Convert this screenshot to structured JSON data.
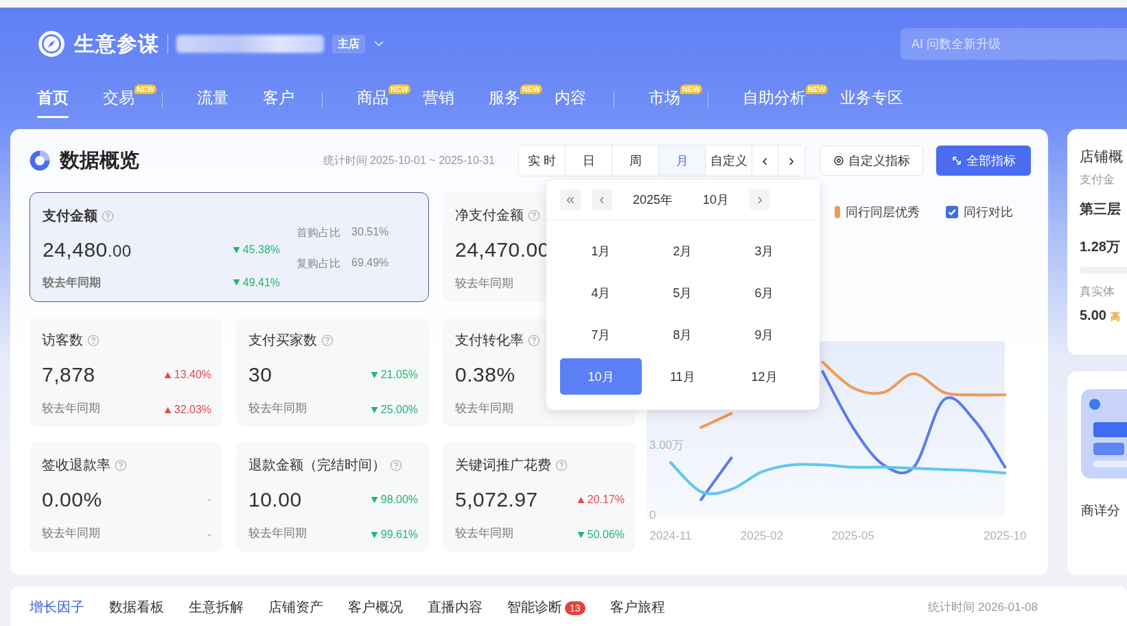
{
  "header": {
    "app_name": "生意参谋",
    "store_badge": "主店",
    "search": {
      "placeholder": "AI 问数全新升级"
    }
  },
  "nav": {
    "groups": [
      [
        {
          "label": "首页",
          "selected": true
        },
        {
          "label": "交易",
          "badge": "NEW",
          "selected": false
        }
      ],
      [
        {
          "label": "流量",
          "selected": false
        },
        {
          "label": "客户",
          "selected": false
        }
      ],
      [
        {
          "label": "商品",
          "badge": "NEW",
          "selected": false
        },
        {
          "label": "营销",
          "selected": false
        },
        {
          "label": "服务",
          "badge": "NEW",
          "selected": false
        },
        {
          "label": "内容",
          "selected": false
        }
      ],
      [
        {
          "label": "市场",
          "badge": "NEW",
          "selected": false
        }
      ],
      [
        {
          "label": "自助分析",
          "badge": "NEW",
          "selected": false
        },
        {
          "label": "业务专区",
          "selected": false
        }
      ]
    ]
  },
  "overview": {
    "title": "数据概览",
    "period": "统计时间 2025-10-01 ~ 2025-10-31",
    "segments": [
      {
        "label": "实 时",
        "selected": false
      },
      {
        "label": "日",
        "selected": false
      },
      {
        "label": "周",
        "selected": false
      },
      {
        "label": "月",
        "selected": true
      },
      {
        "label": "自定义",
        "selected": false
      }
    ],
    "prev": "‹",
    "next": "›",
    "custom_metrics_button": "自定义指标",
    "all_metrics_button": "全部指标"
  },
  "metrics": [
    {
      "title": "支付金额",
      "value": "24,480",
      "value_small": ".00",
      "compare_label": "较去年同期",
      "selected": true,
      "wide": true,
      "changes": [
        {
          "kind": "down",
          "text": "45.38%"
        },
        {
          "kind": "down",
          "text": "49.41%"
        }
      ],
      "shares": [
        {
          "label": "首购占比",
          "value": "30.51%"
        },
        {
          "label": "复购占比",
          "value": "69.49%"
        }
      ]
    },
    {
      "title": "净支付金额",
      "value": "24,470.00",
      "compare_label": "较去年同期",
      "selected": false,
      "wide": false
    },
    {
      "title": "访客数",
      "value": "7,878",
      "compare_label": "较去年同期",
      "selected": false,
      "wide": false,
      "changes": [
        {
          "kind": "up",
          "text": "13.40%"
        },
        {
          "kind": "up",
          "text": "32.03%"
        }
      ]
    },
    {
      "title": "支付买家数",
      "value": "30",
      "compare_label": "较去年同期",
      "selected": false,
      "wide": false,
      "changes": [
        {
          "kind": "down",
          "text": "21.05%"
        },
        {
          "kind": "down",
          "text": "25.00%"
        }
      ]
    },
    {
      "title": "支付转化率",
      "value": "0.38%",
      "compare_label": "较去年同期",
      "selected": false,
      "wide": false
    },
    {
      "title": "签收退款率",
      "value": "0.00%",
      "compare_label": "较去年同期",
      "selected": false,
      "wide": false,
      "changes": [
        {
          "kind": "none",
          "text": "-"
        },
        {
          "kind": "none",
          "text": "-"
        }
      ]
    },
    {
      "title": "退款金额（完结时间）",
      "value": "10.00",
      "compare_label": "较去年同期",
      "selected": false,
      "wide": false,
      "changes": [
        {
          "kind": "down",
          "text": "98.00%"
        },
        {
          "kind": "down",
          "text": "99.61%"
        }
      ]
    },
    {
      "title": "关键词推广花费",
      "value": "5,072.97",
      "compare_label": "较去年同期",
      "selected": false,
      "wide": false,
      "changes": [
        {
          "kind": "up",
          "text": "20.17%"
        },
        {
          "kind": "down",
          "text": "50.06%"
        }
      ]
    }
  ],
  "month_picker": {
    "fast_prev": "«",
    "prev": "‹",
    "year": "2025年",
    "month": "10月",
    "next": "›",
    "months": [
      {
        "label": "1月",
        "selected": false
      },
      {
        "label": "2月",
        "selected": false
      },
      {
        "label": "3月",
        "selected": false
      },
      {
        "label": "4月",
        "selected": false
      },
      {
        "label": "5月",
        "selected": false
      },
      {
        "label": "6月",
        "selected": false
      },
      {
        "label": "7月",
        "selected": false
      },
      {
        "label": "8月",
        "selected": false
      },
      {
        "label": "9月",
        "selected": false
      },
      {
        "label": "10月",
        "selected": true
      },
      {
        "label": "11月",
        "selected": false
      },
      {
        "label": "12月",
        "selected": false
      }
    ]
  },
  "chart": {
    "compare_checkbox": {
      "label": "同行对比",
      "checked": true
    },
    "chart_data": {
      "type": "line",
      "categories": [
        "2024-11",
        null,
        null,
        "2025-02",
        null,
        null,
        "2025-05",
        null,
        null,
        null,
        null,
        "2025-10"
      ],
      "ylim": [
        0,
        7.5
      ],
      "yticks": [
        {
          "value": 0,
          "label": "0"
        },
        {
          "value": 3,
          "label": "3.00万"
        }
      ],
      "series": [
        {
          "name": "同行同层优秀",
          "color": "#ef9a54",
          "values": [
            null,
            3.8,
            4.4,
            null,
            null,
            6.6,
            5.5,
            5.3,
            6.1,
            5.3,
            5.2,
            5.2
          ]
        },
        {
          "color": "#5b7be8",
          "values": [
            null,
            0.7,
            2.5,
            null,
            null,
            6.2,
            3.8,
            2.2,
            2.1,
            5.0,
            4.1,
            2.1
          ]
        },
        {
          "color": "#5ec8ec",
          "values": [
            2.3,
            1.05,
            1.15,
            1.9,
            2.2,
            2.2,
            2.1,
            2.1,
            2.05,
            2.0,
            1.95,
            1.85
          ]
        }
      ]
    }
  },
  "side_panel": {
    "title": "店铺概",
    "subtitle": "支付金",
    "tier": "第三层",
    "amount": "1.28万",
    "real_label": "真实体",
    "score": "5.00",
    "score_tag": "高",
    "detail_label": "商详分"
  },
  "bottom_tabs": {
    "tabs": [
      {
        "label": "增长因子",
        "selected": true
      },
      {
        "label": "数据看板",
        "selected": false
      },
      {
        "label": "生意拆解",
        "selected": false
      },
      {
        "label": "店铺资产",
        "selected": false
      },
      {
        "label": "客户概况",
        "selected": false
      },
      {
        "label": "直播内容",
        "selected": false
      },
      {
        "label": "智能诊断",
        "badge": "13",
        "selected": false
      },
      {
        "label": "客户旅程",
        "selected": false
      }
    ],
    "stat_time": "统计时间 2026-01-08"
  }
}
